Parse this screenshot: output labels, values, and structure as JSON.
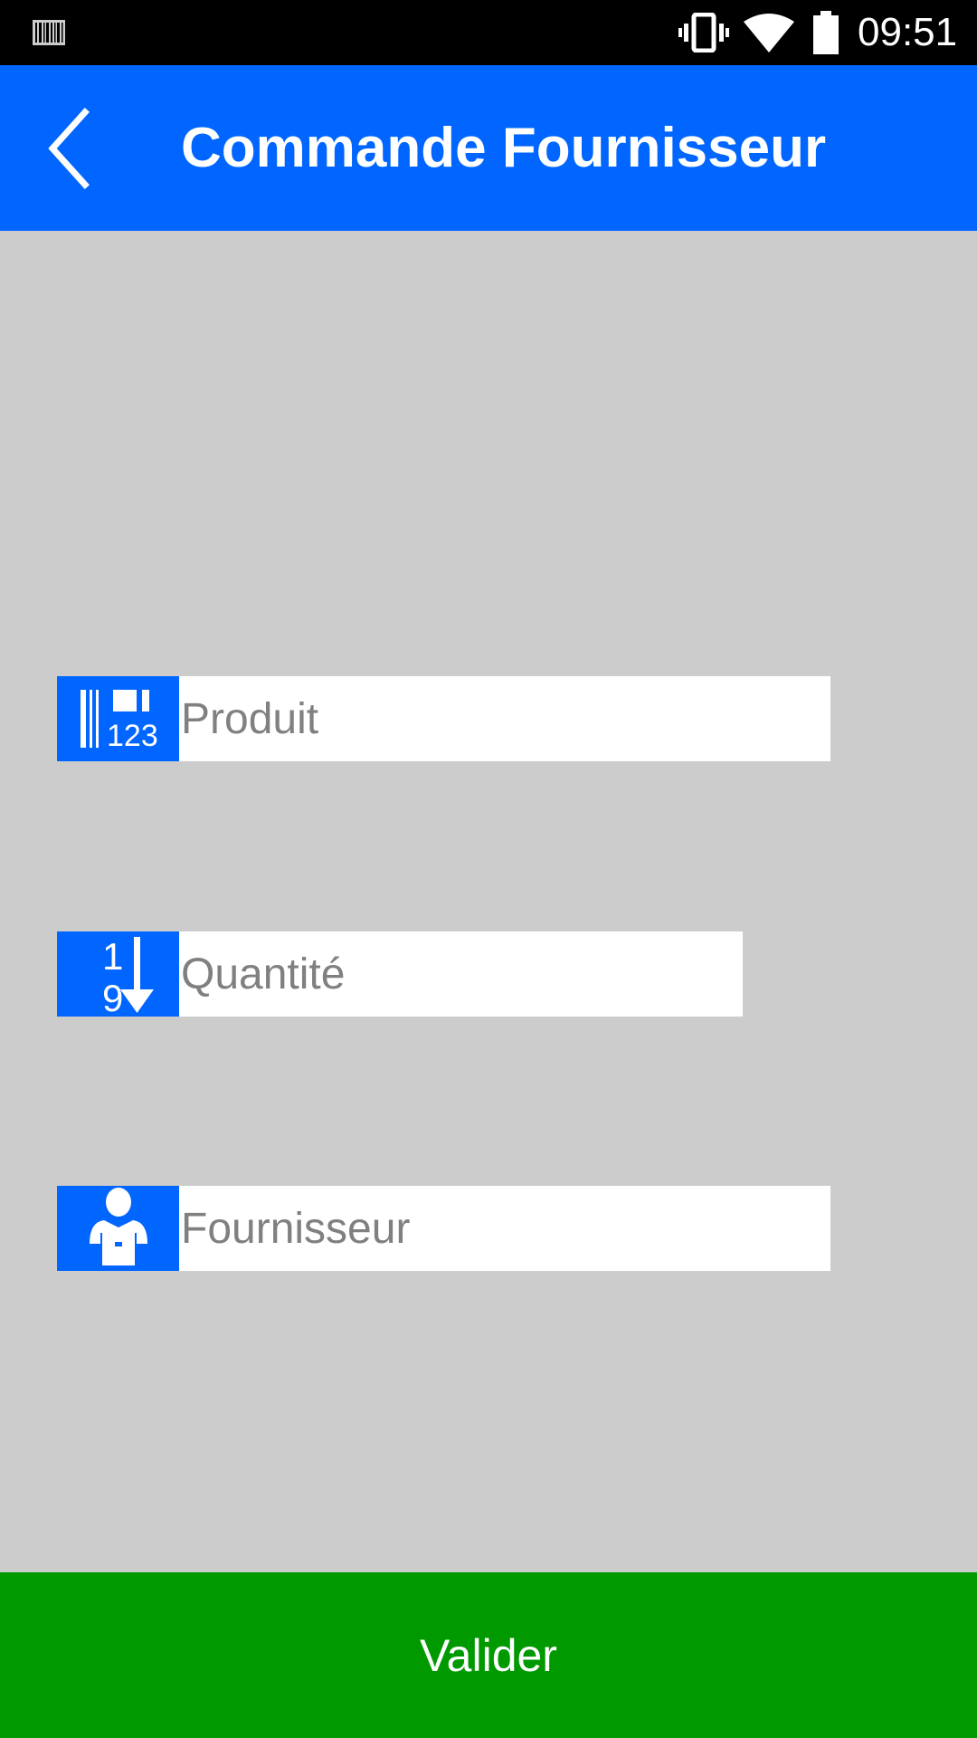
{
  "status_bar": {
    "time": "09:51",
    "icons": [
      "barcode-icon",
      "vibrate-icon",
      "wifi-icon",
      "battery-icon"
    ]
  },
  "app_bar": {
    "title": "Commande Fournisseur",
    "back_icon": "chevron-left-icon",
    "color": "#0066ff"
  },
  "form": {
    "produit": {
      "placeholder": "Produit",
      "icon": "barcode-123-icon",
      "value": ""
    },
    "quantite": {
      "placeholder": "Quantité",
      "icon": "sort-1-9-down-icon",
      "value": ""
    },
    "fournisseur": {
      "placeholder": "Fournisseur",
      "icon": "supplier-person-icon",
      "value": ""
    }
  },
  "valider": {
    "label": "Valider",
    "color": "#009900"
  },
  "colors": {
    "background": "#cccccc",
    "accent": "#0066ff",
    "status_bar": "#000000"
  }
}
